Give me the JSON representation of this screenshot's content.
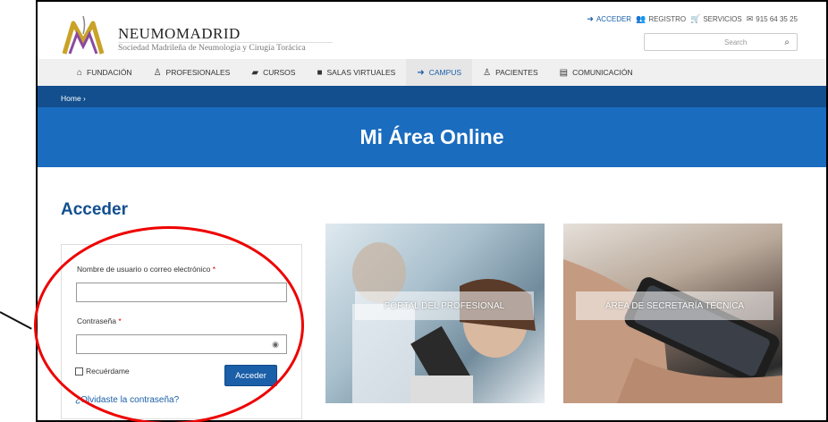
{
  "brand": {
    "name": "NEUMOMADRID",
    "subtitle": "Sociedad Madrileña de Neumología y Cirugía Torácica"
  },
  "toplinks": [
    {
      "icon": "sign-in-icon",
      "glyph": "➜",
      "label": "ACCEDER"
    },
    {
      "icon": "users-icon",
      "glyph": "👥",
      "label": "REGISTRO"
    },
    {
      "icon": "cart-icon",
      "glyph": "🛒",
      "label": "SERVICIOS"
    },
    {
      "icon": "envelope-icon",
      "glyph": "✉",
      "label": "915 64 35 25"
    }
  ],
  "search": {
    "placeholder": "Search"
  },
  "nav": [
    {
      "icon": "home-icon",
      "glyph": "⌂",
      "label": "FUNDACIÓN"
    },
    {
      "icon": "user-md-icon",
      "glyph": "♙",
      "label": "PROFESIONALES"
    },
    {
      "icon": "graduation-cap-icon",
      "glyph": "▰",
      "label": "CURSOS"
    },
    {
      "icon": "video-camera-icon",
      "glyph": "■",
      "label": "SALAS VIRTUALES"
    },
    {
      "icon": "sign-in-icon",
      "glyph": "➜",
      "label": "CAMPUS"
    },
    {
      "icon": "user-icon",
      "glyph": "♙",
      "label": "PACIENTES"
    },
    {
      "icon": "book-icon",
      "glyph": "▤",
      "label": "COMUNICACIÓN"
    }
  ],
  "active_nav": "CAMPUS",
  "breadcrumb": "Home ›",
  "banner_title": "Mi Área Online",
  "login": {
    "heading": "Acceder",
    "username_label": "Nombre de usuario o correo electrónico",
    "password_label": "Contraseña",
    "required_mark": "*",
    "username_value": "",
    "password_value": "",
    "remember_label": "Recuérdame",
    "submit_label": "Acceder",
    "forgot_label": "¿Olvidaste la contraseña?"
  },
  "tiles": [
    {
      "label": "PORTAL DEL PROFESIONAL"
    },
    {
      "label": "ÁREA DE SECRETARÍA TÉCNICA"
    }
  ],
  "colors": {
    "primary": "#1a5fa8",
    "banner": "#1a6cbf",
    "breadcrumb": "#134f8f",
    "annotation": "#e00000"
  }
}
